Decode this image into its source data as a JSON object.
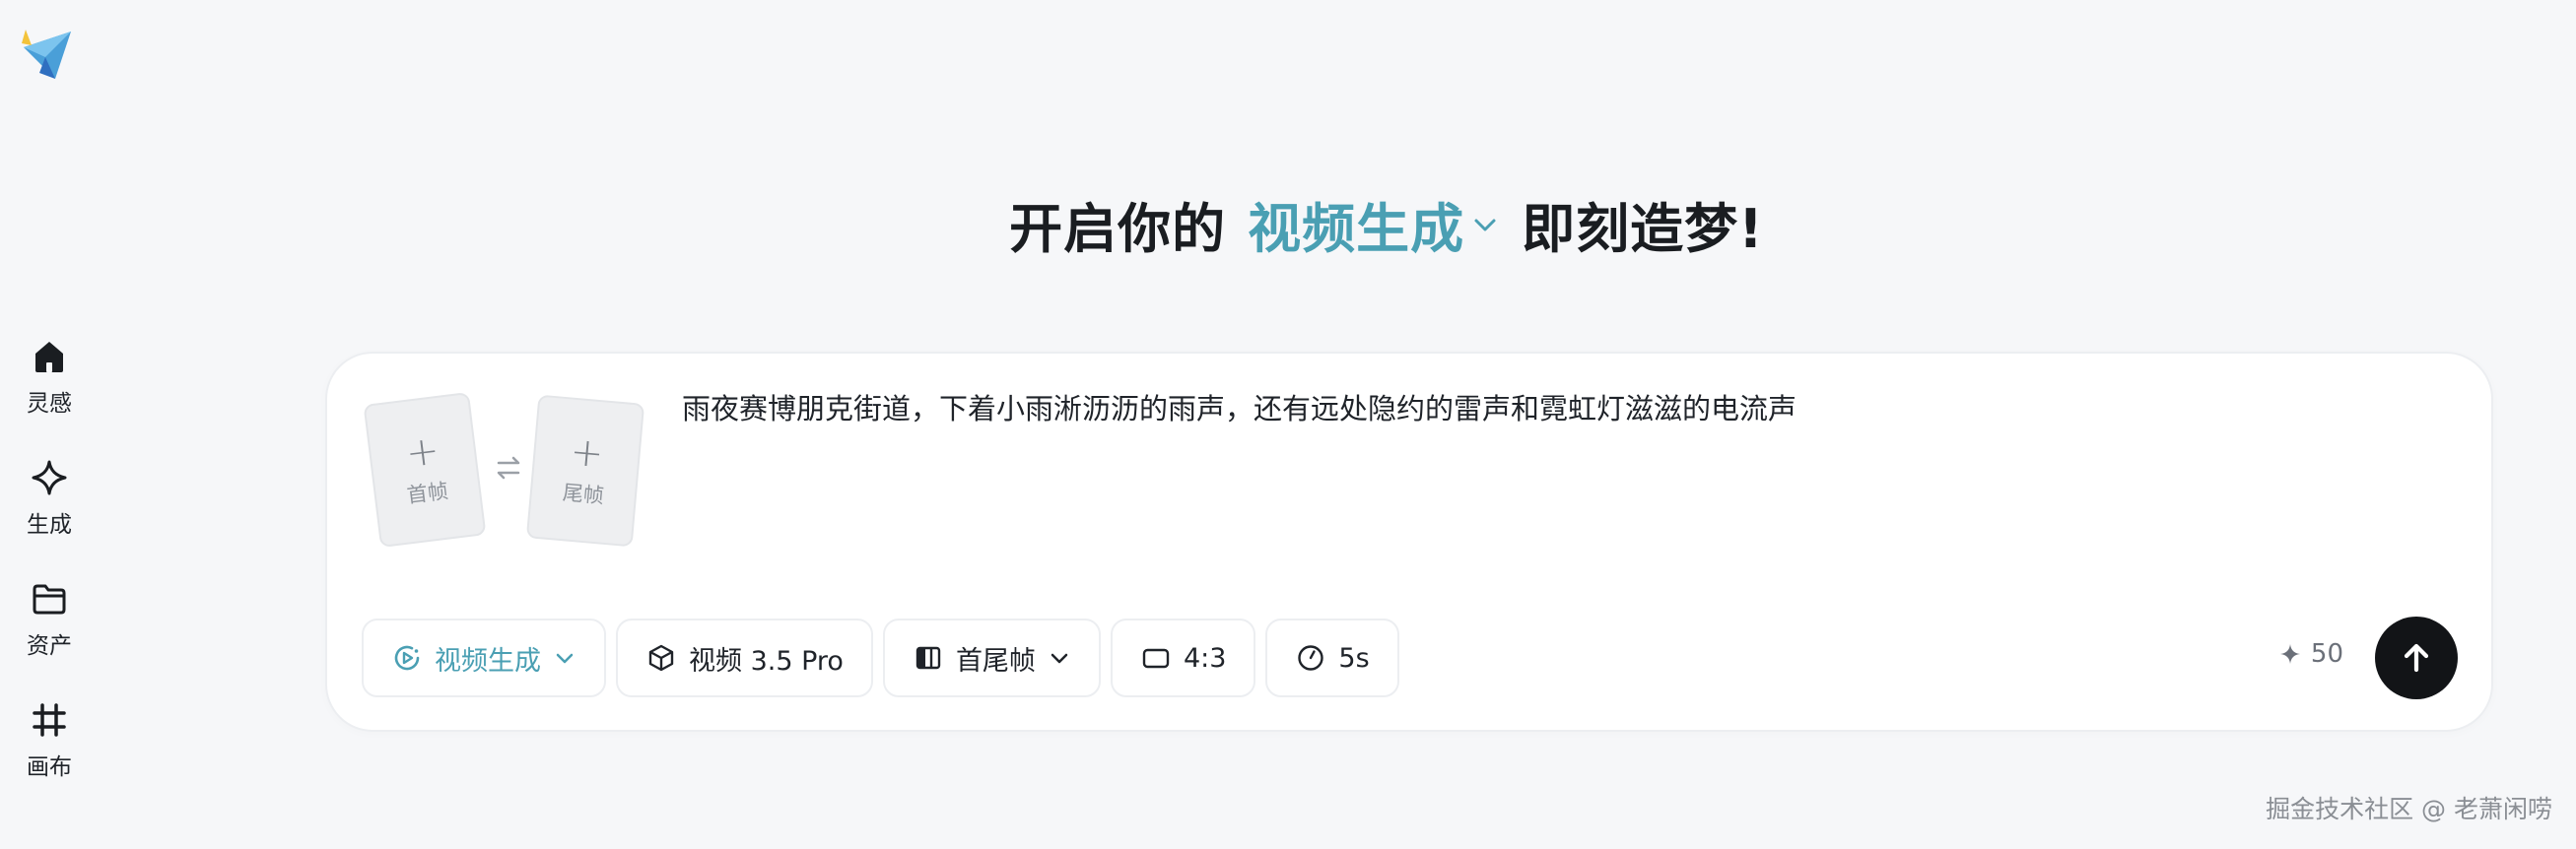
{
  "sidebar": {
    "items": [
      {
        "label": "灵感",
        "icon": "home-icon"
      },
      {
        "label": "生成",
        "icon": "sparkle-icon"
      },
      {
        "label": "资产",
        "icon": "folder-icon"
      },
      {
        "label": "画布",
        "icon": "canvas-icon"
      }
    ]
  },
  "heading": {
    "prefix": "开启你的",
    "mode": "视频生成",
    "suffix": "即刻造梦!"
  },
  "frames": {
    "first_label": "首帧",
    "last_label": "尾帧",
    "plus": "+"
  },
  "prompt": {
    "text": "雨夜赛博朋克街道，下着小雨淅沥沥的雨声，还有远处隐约的雷声和霓虹灯滋滋的电流声"
  },
  "toolbar": {
    "mode_label": "视频生成",
    "model_label": "视频 3.5 Pro",
    "frame_mode_label": "首尾帧",
    "ratio_label": "4:3",
    "duration_label": "5s"
  },
  "credits": {
    "value": "50"
  },
  "watermark": "掘金技术社区 @ 老萧闲唠",
  "colors": {
    "accent": "#4a9fb3",
    "background": "#f6f7f9",
    "send_button": "#121417"
  }
}
